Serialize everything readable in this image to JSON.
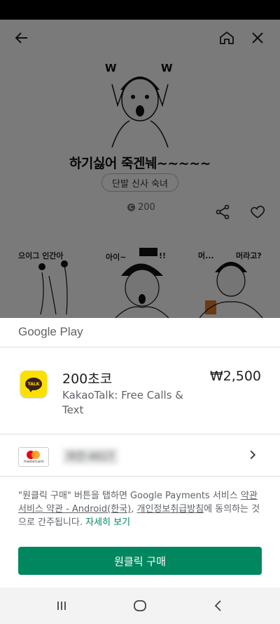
{
  "app": {
    "sticker_title": "하기싫어 죽겐눼~~~~~",
    "author": "단발 신사 숙녀",
    "price": "200",
    "hero_letters": [
      "W",
      "O",
      "W"
    ],
    "sticker_captions": [
      "으이그  인간아",
      "아이~",
      "!!",
      "머...",
      "머라고?"
    ]
  },
  "sheet": {
    "brand": "Google Play",
    "product": {
      "name": "200초코",
      "app_name": "KakaoTalk: Free Calls & Text",
      "price": "₩2,500",
      "icon_text": "TALK"
    },
    "payment": {
      "card_logo_text": "mastercard",
      "card_number": "와칸-4617"
    },
    "legal": {
      "part1": "\"원클릭 구매\" 버튼을 탭하면 Google Payments 서비스 ",
      "link1": "약관",
      "part2": " ",
      "link2": "서비스 약관 - Android(한국)",
      "part3": ", ",
      "link3": "개인정보취급방침",
      "part4": "에 동의하는 것으로 간주됩니다. ",
      "more": "자세히 보기"
    },
    "buy_label": "원클릭 구매"
  },
  "colors": {
    "accent": "#01875f",
    "kakao_yellow": "#fae100"
  },
  "icons": [
    "back-arrow-icon",
    "home-icon",
    "close-icon",
    "share-icon",
    "heart-icon",
    "chevron-right-icon",
    "recents-icon",
    "home-circle-icon",
    "back-chevron-icon"
  ]
}
